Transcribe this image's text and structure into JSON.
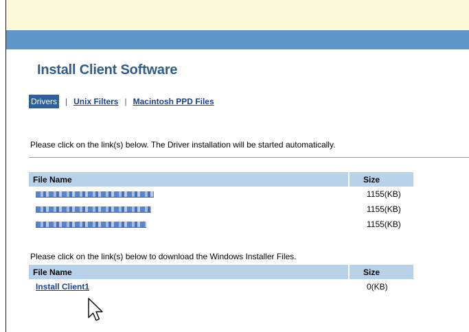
{
  "page": {
    "title": "Install Client Software"
  },
  "tabs": [
    {
      "label": "Drivers",
      "active": true
    },
    {
      "label": "Unix Filters",
      "active": false
    },
    {
      "label": "Macintosh PPD Files",
      "active": false
    }
  ],
  "drivers_section": {
    "instruction": "Please click on the link(s) below. The Driver installation will be started automatically.",
    "columns": [
      "File Name",
      "Size"
    ],
    "rows": [
      {
        "name": "",
        "size": "1155(KB)",
        "blurred": true
      },
      {
        "name": "",
        "size": "1155(KB)",
        "blurred": true
      },
      {
        "name": "",
        "size": "1155(KB)",
        "blurred": true
      }
    ]
  },
  "installer_section": {
    "instruction": "Please click on the link(s) below to download the Windows Installer Files.",
    "columns": [
      "File Name",
      "Size"
    ],
    "rows": [
      {
        "name": "Install Client1",
        "size": "0(KB)"
      }
    ]
  },
  "colors": {
    "top_band": "#fbfad9",
    "header_band": "#5f97c9",
    "title": "#2e5c8c",
    "active_tab_bg": "#2f5f98",
    "table_header_bg": "#b8d2ea",
    "link": "#1a3f8c"
  },
  "icons": {
    "cursor": "mouse-pointer-icon"
  }
}
